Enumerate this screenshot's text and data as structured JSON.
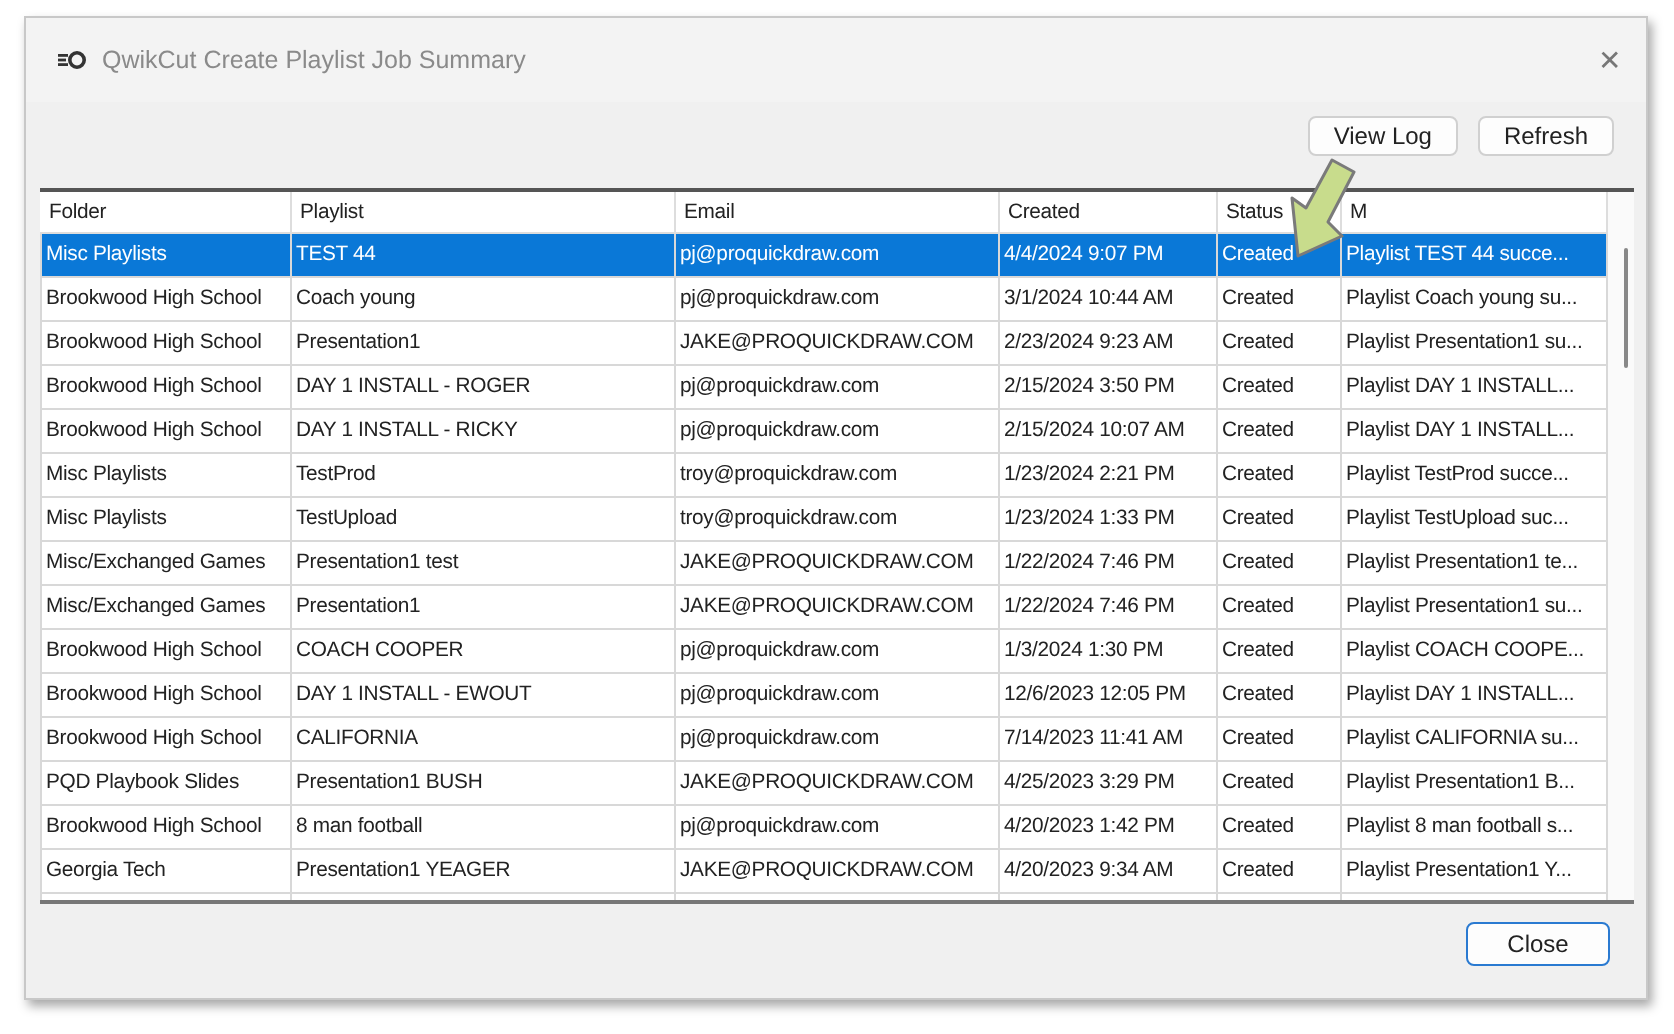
{
  "window": {
    "title": "QwikCut Create Playlist Job Summary",
    "close": "✕"
  },
  "toolbar": {
    "buttons": [
      "View Log",
      "Refresh"
    ]
  },
  "table": {
    "columns": [
      "Folder",
      "Playlist",
      "Email",
      "Created",
      "Status",
      "M"
    ],
    "rows": [
      {
        "selected": true,
        "cells": [
          "Misc Playlists",
          "TEST 44",
          "pj@proquickdraw.com",
          "4/4/2024 9:07 PM",
          "Created",
          "Playlist TEST 44 succe..."
        ]
      },
      {
        "selected": false,
        "cells": [
          "Brookwood High School",
          "Coach young",
          "pj@proquickdraw.com",
          "3/1/2024 10:44 AM",
          "Created",
          "Playlist Coach young su..."
        ]
      },
      {
        "selected": false,
        "cells": [
          "Brookwood High School",
          "Presentation1",
          "JAKE@PROQUICKDRAW.COM",
          "2/23/2024 9:23 AM",
          "Created",
          "Playlist Presentation1 su..."
        ]
      },
      {
        "selected": false,
        "cells": [
          "Brookwood High School",
          "DAY 1 INSTALL - ROGER",
          "pj@proquickdraw.com",
          "2/15/2024 3:50 PM",
          "Created",
          "Playlist DAY 1 INSTALL..."
        ]
      },
      {
        "selected": false,
        "cells": [
          "Brookwood High School",
          "DAY 1 INSTALL - RICKY",
          "pj@proquickdraw.com",
          "2/15/2024 10:07 AM",
          "Created",
          "Playlist DAY 1 INSTALL..."
        ]
      },
      {
        "selected": false,
        "cells": [
          "Misc Playlists",
          "TestProd",
          "troy@proquickdraw.com",
          "1/23/2024 2:21 PM",
          "Created",
          "Playlist TestProd succe..."
        ]
      },
      {
        "selected": false,
        "cells": [
          "Misc Playlists",
          "TestUpload",
          "troy@proquickdraw.com",
          "1/23/2024 1:33 PM",
          "Created",
          "Playlist TestUpload suc..."
        ]
      },
      {
        "selected": false,
        "cells": [
          "Misc/Exchanged Games",
          "Presentation1 test",
          "JAKE@PROQUICKDRAW.COM",
          "1/22/2024 7:46 PM",
          "Created",
          "Playlist Presentation1 te..."
        ]
      },
      {
        "selected": false,
        "cells": [
          "Misc/Exchanged Games",
          "Presentation1",
          "JAKE@PROQUICKDRAW.COM",
          "1/22/2024 7:46 PM",
          "Created",
          "Playlist Presentation1 su..."
        ]
      },
      {
        "selected": false,
        "cells": [
          "Brookwood High School",
          "COACH COOPER",
          "pj@proquickdraw.com",
          "1/3/2024 1:30 PM",
          "Created",
          "Playlist COACH COOPE..."
        ]
      },
      {
        "selected": false,
        "cells": [
          "Brookwood High School",
          "DAY 1 INSTALL - EWOUT",
          "pj@proquickdraw.com",
          "12/6/2023 12:05 PM",
          "Created",
          "Playlist DAY 1 INSTALL..."
        ]
      },
      {
        "selected": false,
        "cells": [
          "Brookwood High School",
          "CALIFORNIA",
          "pj@proquickdraw.com",
          "7/14/2023 11:41 AM",
          "Created",
          "Playlist CALIFORNIA su..."
        ]
      },
      {
        "selected": false,
        "cells": [
          "PQD Playbook Slides",
          "Presentation1 BUSH",
          "JAKE@PROQUICKDRAW.COM",
          "4/25/2023 3:29 PM",
          "Created",
          "Playlist Presentation1 B..."
        ]
      },
      {
        "selected": false,
        "cells": [
          "Brookwood High School",
          "8 man football",
          "pj@proquickdraw.com",
          "4/20/2023 1:42 PM",
          "Created",
          "Playlist 8 man football s..."
        ]
      },
      {
        "selected": false,
        "cells": [
          "Georgia Tech",
          "Presentation1 YEAGER",
          "JAKE@PROQUICKDRAW.COM",
          "4/20/2023 9:34 AM",
          "Created",
          "Playlist Presentation1 Y..."
        ]
      }
    ]
  },
  "footer": {
    "buttons": [
      "Close"
    ]
  }
}
